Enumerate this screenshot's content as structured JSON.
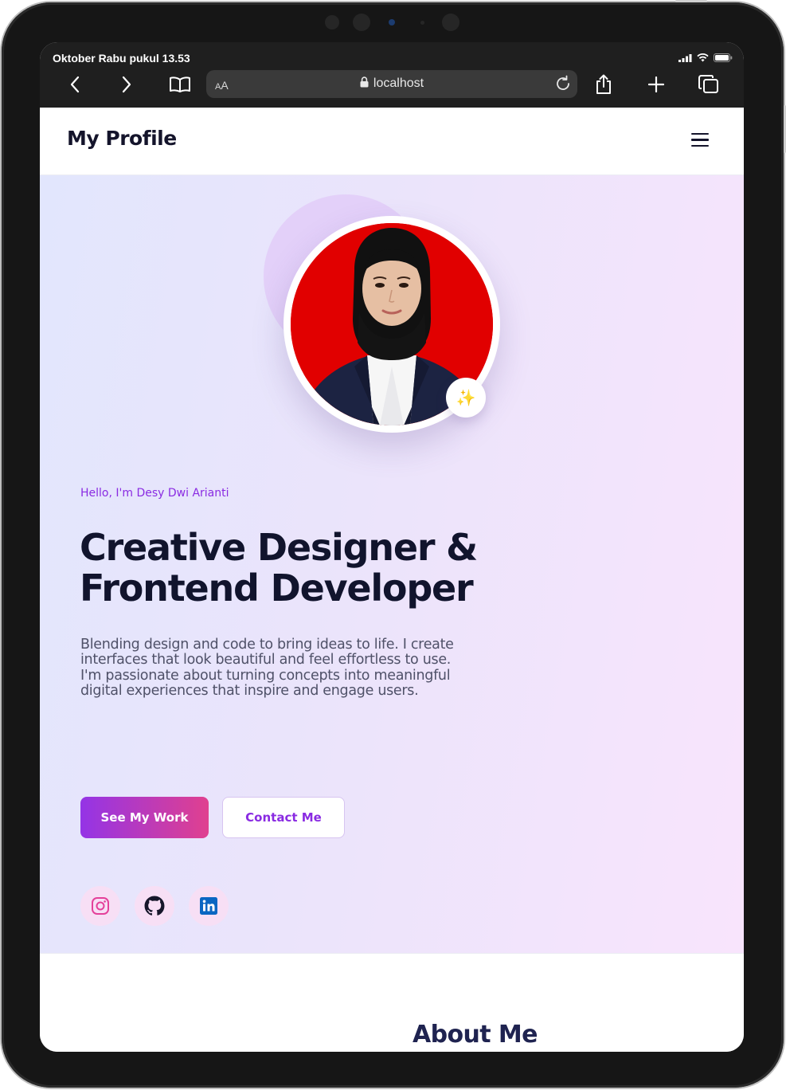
{
  "status_bar": {
    "time": "Oktober Rabu pukul 13.53"
  },
  "browser": {
    "text_size_label_big": "A",
    "text_size_label_small": "A",
    "url": "localhost"
  },
  "header": {
    "brand": "My Profile"
  },
  "hero": {
    "greeting": "Hello, I'm Desy Dwi Arianti",
    "headline_line1": "Creative Designer &",
    "headline_line2": "Frontend Developer",
    "bio": "Blending design and code to bring ideas to life. I create interfaces that look beautiful and feel effortless to use. I'm passionate about turning concepts into meaningful digital experiences that inspire and engage users.",
    "badge_emoji": "✨",
    "primary_button": "See My Work",
    "secondary_button": "Contact Me",
    "socials": [
      "instagram-icon",
      "github-icon",
      "linkedin-icon"
    ]
  },
  "about": {
    "title": "About Me"
  },
  "colors": {
    "accent_purple": "#8a2be2",
    "gradient_start": "#9434e6",
    "gradient_end": "#e0408f",
    "heading_dark": "#11142d",
    "photo_background": "#e10000"
  }
}
